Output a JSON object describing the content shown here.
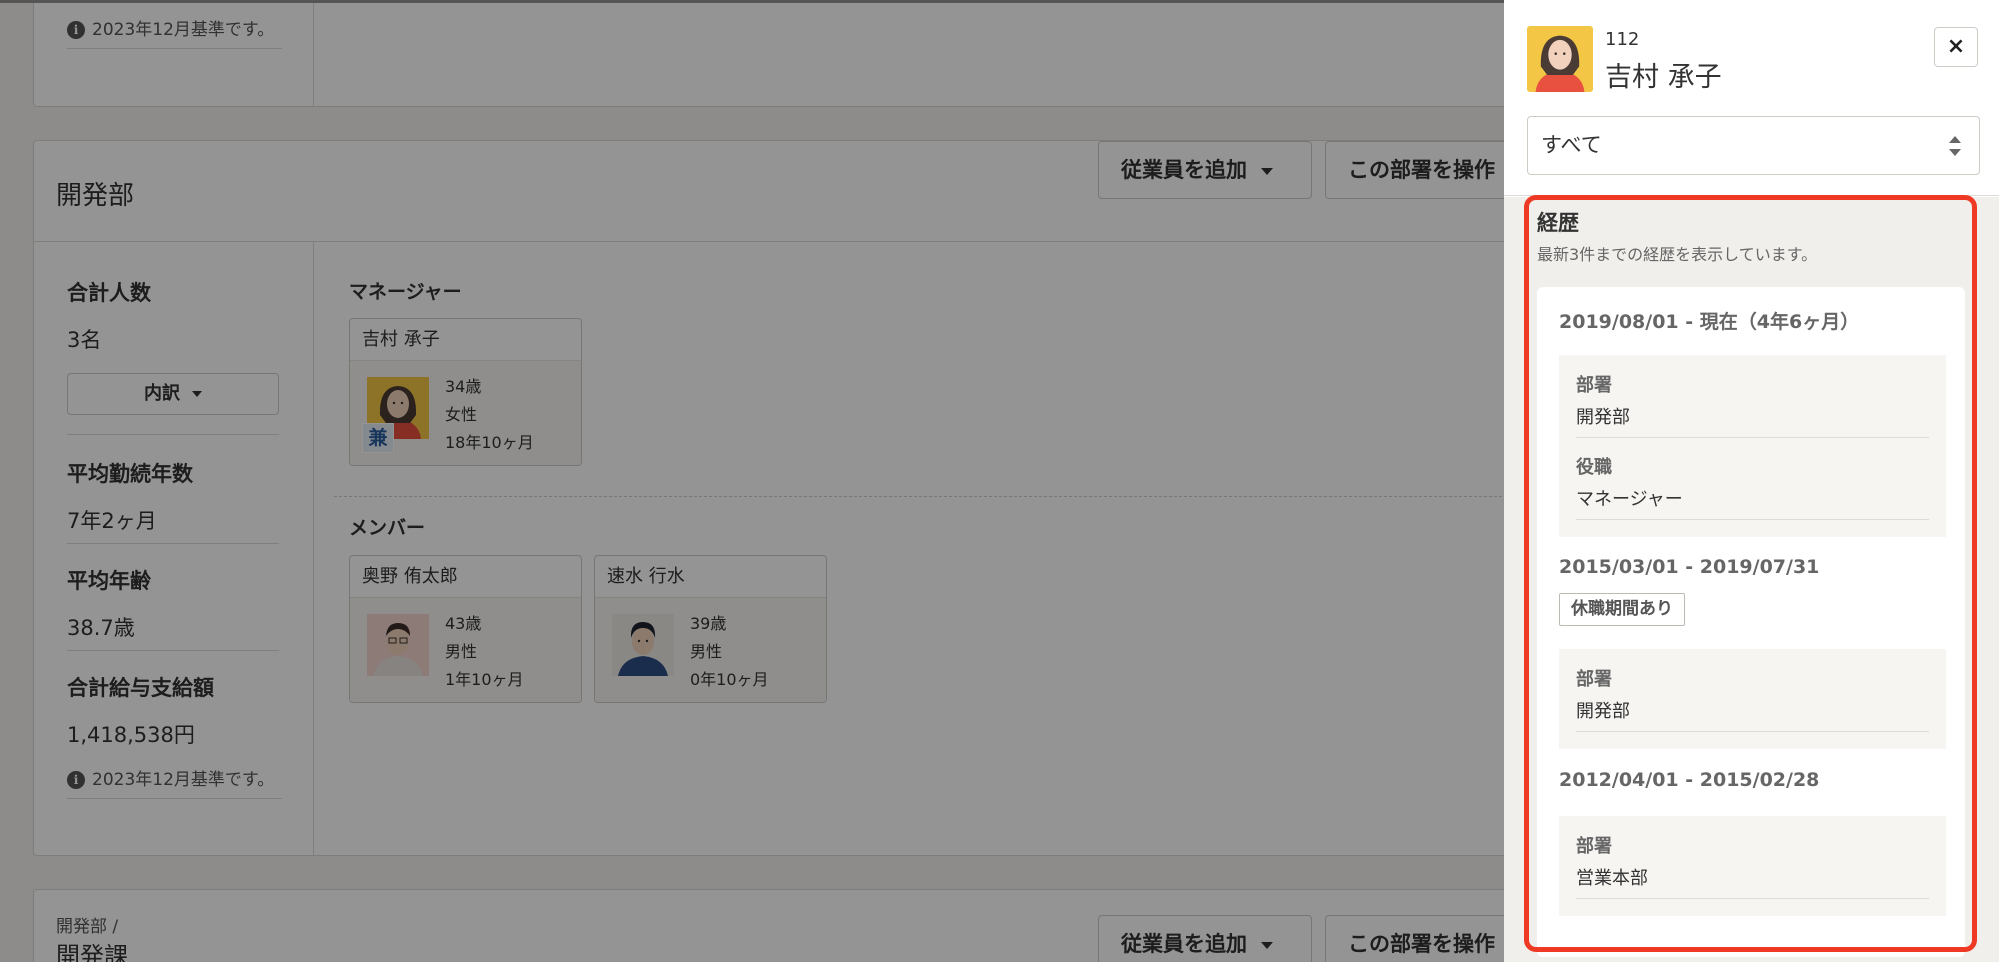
{
  "background": {
    "top_note": "2023年12月基準です。",
    "dept": {
      "title": "開発部",
      "add_employee_button": "従業員を追加",
      "operate_dept_button": "この部署を操作",
      "stats": {
        "total_label": "合計人数",
        "total_value": "3名",
        "breakdown_button": "内訳",
        "avg_tenure_label": "平均勤続年数",
        "avg_tenure_value": "7年2ヶ月",
        "avg_age_label": "平均年齢",
        "avg_age_value": "38.7歳",
        "total_salary_label": "合計給与支給額",
        "total_salary_value": "1,418,538円",
        "note": "2023年12月基準です。"
      },
      "manager_label": "マネージャー",
      "member_label": "メンバー",
      "manager": {
        "name": "吉村 承子",
        "age": "34歳",
        "gender": "女性",
        "tenure": "18年10ヶ月",
        "badge": "兼"
      },
      "members": [
        {
          "name": "奥野 侑太郎",
          "age": "43歳",
          "gender": "男性",
          "tenure": "1年10ヶ月"
        },
        {
          "name": "速水 行水",
          "age": "39歳",
          "gender": "男性",
          "tenure": "0年10ヶ月"
        }
      ]
    },
    "next_dept": {
      "breadcrumb": "開発部 /",
      "title": "開発課",
      "add_employee_button": "従業員を追加",
      "operate_dept_button": "この部署を操作"
    }
  },
  "panel": {
    "employee_number": "112",
    "employee_name": "吉村 承子",
    "close_label": "×",
    "filter_value": "すべて",
    "history_title": "経歴",
    "history_subtitle": "最新3件までの経歴を表示しています。",
    "history": [
      {
        "period": "2019/08/01 - 現在（4年6ヶ月）",
        "dept_label": "部署",
        "dept": "開発部",
        "position_label": "役職",
        "position": "マネージャー"
      },
      {
        "period": "2015/03/01 - 2019/07/31",
        "badge": "休職期間あり",
        "dept_label": "部署",
        "dept": "開発部"
      },
      {
        "period": "2012/04/01 - 2015/02/28",
        "dept_label": "部署",
        "dept": "営業本部"
      }
    ]
  },
  "colors": {
    "highlight": "#ee3a24",
    "overlay": "rgba(0,0,0,0.42)",
    "panel_body": "#f1efeb"
  }
}
